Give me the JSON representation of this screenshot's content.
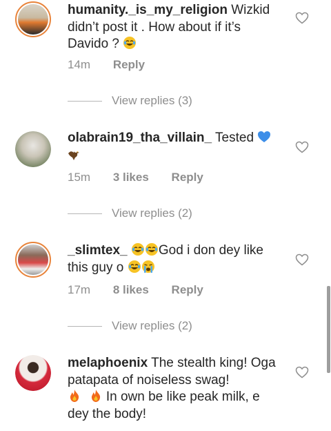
{
  "comments": [
    {
      "username": "humanity._is_my_religion",
      "text": "Wizkid didn’t post it . How about if it’s Davido ?",
      "emoji_end": "face-with-tears-of-joy",
      "time": "14m",
      "likes": "",
      "reply": "Reply",
      "view_replies": "View replies (3)"
    },
    {
      "username": "olabrain19_tha_villain_",
      "text": "Tested",
      "emoji": "blue-heart, eagle",
      "time": "15m",
      "likes": "3 likes",
      "reply": "Reply",
      "view_replies": "View replies (2)"
    },
    {
      "username": "_slimtex_",
      "text_a": "God i don dey like this guy o",
      "emoji": "face-with-tears-of-joy x3, loudly-crying-face",
      "time": "17m",
      "likes": "8 likes",
      "reply": "Reply",
      "view_replies": "View replies (2)"
    },
    {
      "username": "melaphoenix",
      "text_a": "The stealth king! Oga patapata of noiseless swag!",
      "text_b": "In own be like peak milk, e dey the body!",
      "emoji": "fire x2"
    }
  ],
  "colors": {
    "meta": "#8e8e8e",
    "text": "#262626",
    "ring": "#e8833a",
    "blue_heart": "#3d8ee8"
  },
  "icons": [
    "heart-outline-icon",
    "avatar"
  ]
}
